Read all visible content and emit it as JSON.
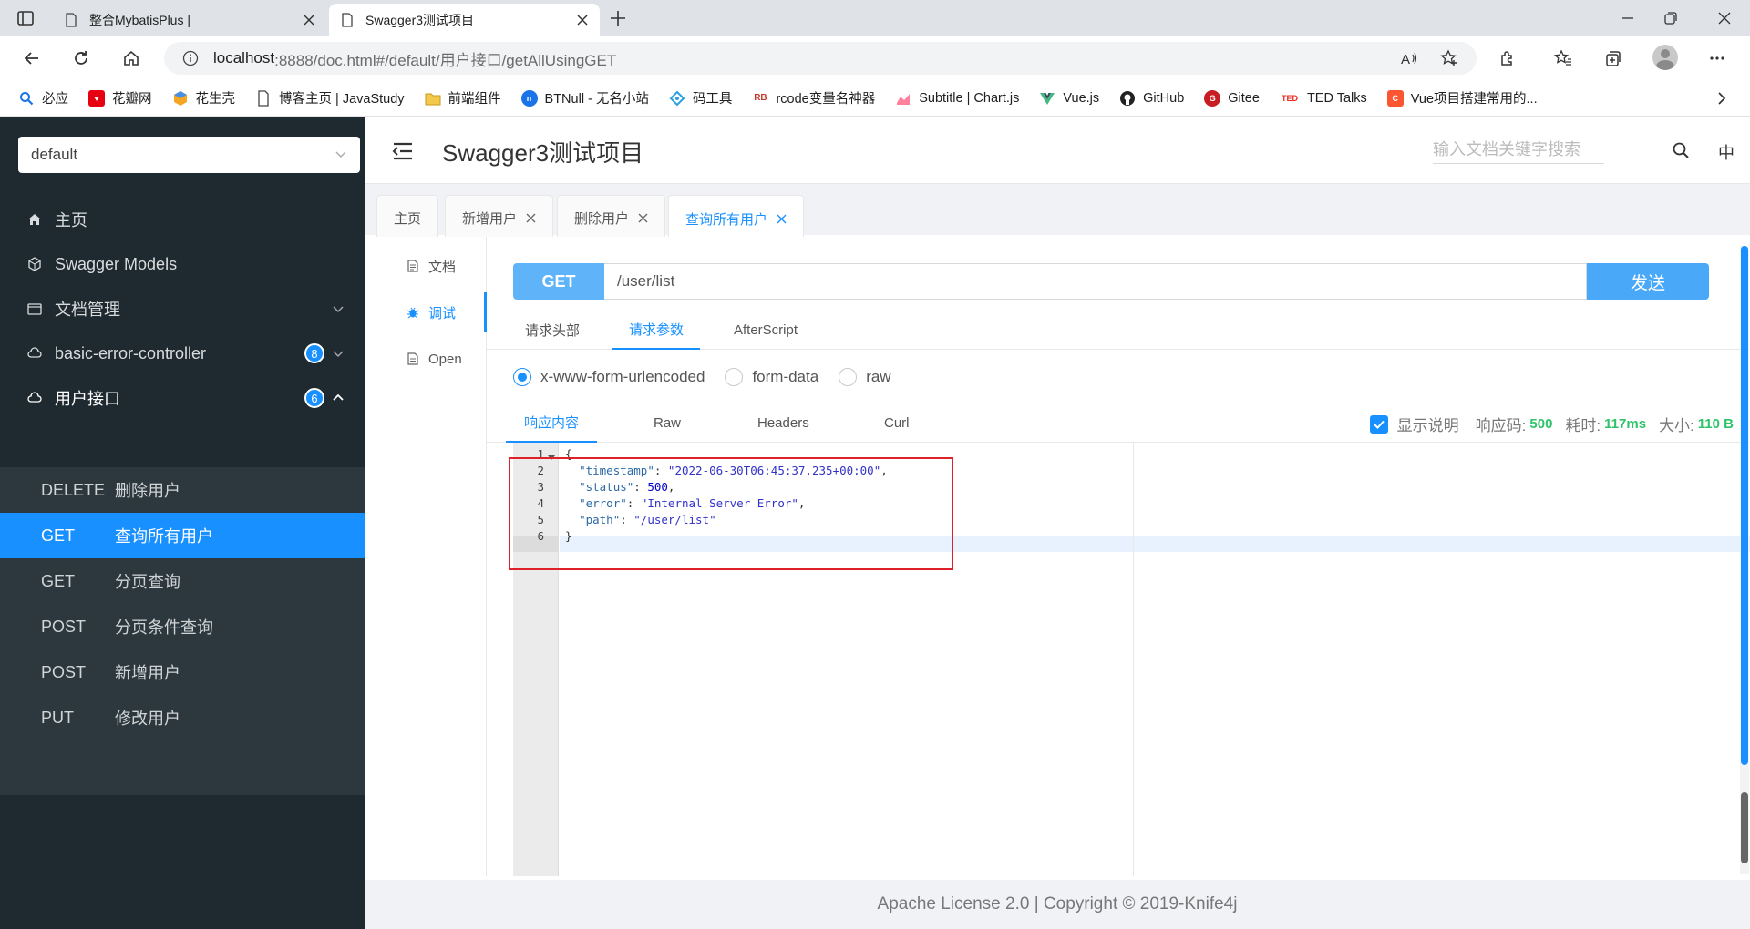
{
  "browser": {
    "tabs": [
      {
        "title": "整合MybatisPlus |",
        "active": false
      },
      {
        "title": "Swagger3测试项目",
        "active": true
      }
    ],
    "url_host": "localhost",
    "url_rest": ":8888/doc.html#/default/用户接口/getAllUsingGET",
    "bookmarks": [
      {
        "label": "必应",
        "icon": "search-icon",
        "color": "#1a73e8"
      },
      {
        "label": "花瓣网",
        "icon": "huaban-icon",
        "color": "#e60012"
      },
      {
        "label": "花生壳",
        "icon": "huashengke-icon",
        "color": "#f5a623"
      },
      {
        "label": "博客主页 | JavaStudy",
        "icon": "page-icon",
        "color": "#555555"
      },
      {
        "label": "前端组件",
        "icon": "folder-icon",
        "color": "#e8b93a"
      },
      {
        "label": "BTNull - 无名小站",
        "icon": "btnull-icon",
        "color": "#1a73e8"
      },
      {
        "label": "码工具",
        "icon": "tool-icon",
        "color": "#2b9fe0"
      },
      {
        "label": "rcode变量名神器",
        "icon": "rb-icon",
        "color": "#c0392b"
      },
      {
        "label": "Subtitle | Chart.js",
        "icon": "chartjs-icon",
        "color": "#ff6384"
      },
      {
        "label": "Vue.js",
        "icon": "vue-icon",
        "color": "#42b883"
      },
      {
        "label": "GitHub",
        "icon": "github-icon",
        "color": "#222222"
      },
      {
        "label": "Gitee",
        "icon": "gitee-icon",
        "color": "#c71d23"
      },
      {
        "label": "TED Talks",
        "icon": "ted-icon",
        "color": "#e62b1e"
      },
      {
        "label": "Vue项目搭建常用的...",
        "icon": "c-icon",
        "color": "#fc5531"
      }
    ]
  },
  "sidebar": {
    "group": "default",
    "menu": [
      {
        "label": "主页",
        "icon": "home-icon"
      },
      {
        "label": "Swagger Models",
        "icon": "models-icon"
      },
      {
        "label": "文档管理",
        "icon": "folder-icon"
      },
      {
        "label": "basic-error-controller",
        "icon": "cloud-icon",
        "badge": "8"
      },
      {
        "label": "用户接口",
        "icon": "cloud-icon",
        "badge": "6"
      }
    ],
    "apis": [
      {
        "method": "DELETE",
        "name": "删除用户"
      },
      {
        "method": "GET",
        "name": "查询所有用户",
        "active": true
      },
      {
        "method": "GET",
        "name": "分页查询"
      },
      {
        "method": "POST",
        "name": "分页条件查询"
      },
      {
        "method": "POST",
        "name": "新增用户"
      },
      {
        "method": "PUT",
        "name": "修改用户"
      }
    ]
  },
  "header": {
    "title": "Swagger3测试项目",
    "search_placeholder": "输入文档关键字搜索",
    "lang": "中"
  },
  "doc_tabs": [
    "主页",
    "新增用户",
    "删除用户",
    "查询所有用户"
  ],
  "side_nav": [
    "文档",
    "调试",
    "Open"
  ],
  "request": {
    "method": "GET",
    "url": "/user/list",
    "send_label": "发送"
  },
  "param_tabs": [
    "请求头部",
    "请求参数",
    "AfterScript"
  ],
  "body_types": [
    "x-www-form-urlencoded",
    "form-data",
    "raw"
  ],
  "response_tabs": [
    "响应内容",
    "Raw",
    "Headers",
    "Curl"
  ],
  "response_meta": {
    "show_desc": "显示说明",
    "code_label": "响应码:",
    "code": "500",
    "time_label": "耗时:",
    "time": "117ms",
    "size_label": "大小:",
    "size": "110 B"
  },
  "response_body": {
    "line_numbers": [
      "1",
      "2",
      "3",
      "4",
      "5",
      "6"
    ],
    "timestamp_key": "\"timestamp\"",
    "timestamp_val": "\"2022-06-30T06:45:37.235+00:00\"",
    "status_key": "\"status\"",
    "status_val": "500",
    "error_key": "\"error\"",
    "error_val": "\"Internal Server Error\"",
    "path_key": "\"path\"",
    "path_val": "\"/user/list\""
  },
  "footer": "Apache License 2.0 | Copyright © 2019-Knife4j"
}
